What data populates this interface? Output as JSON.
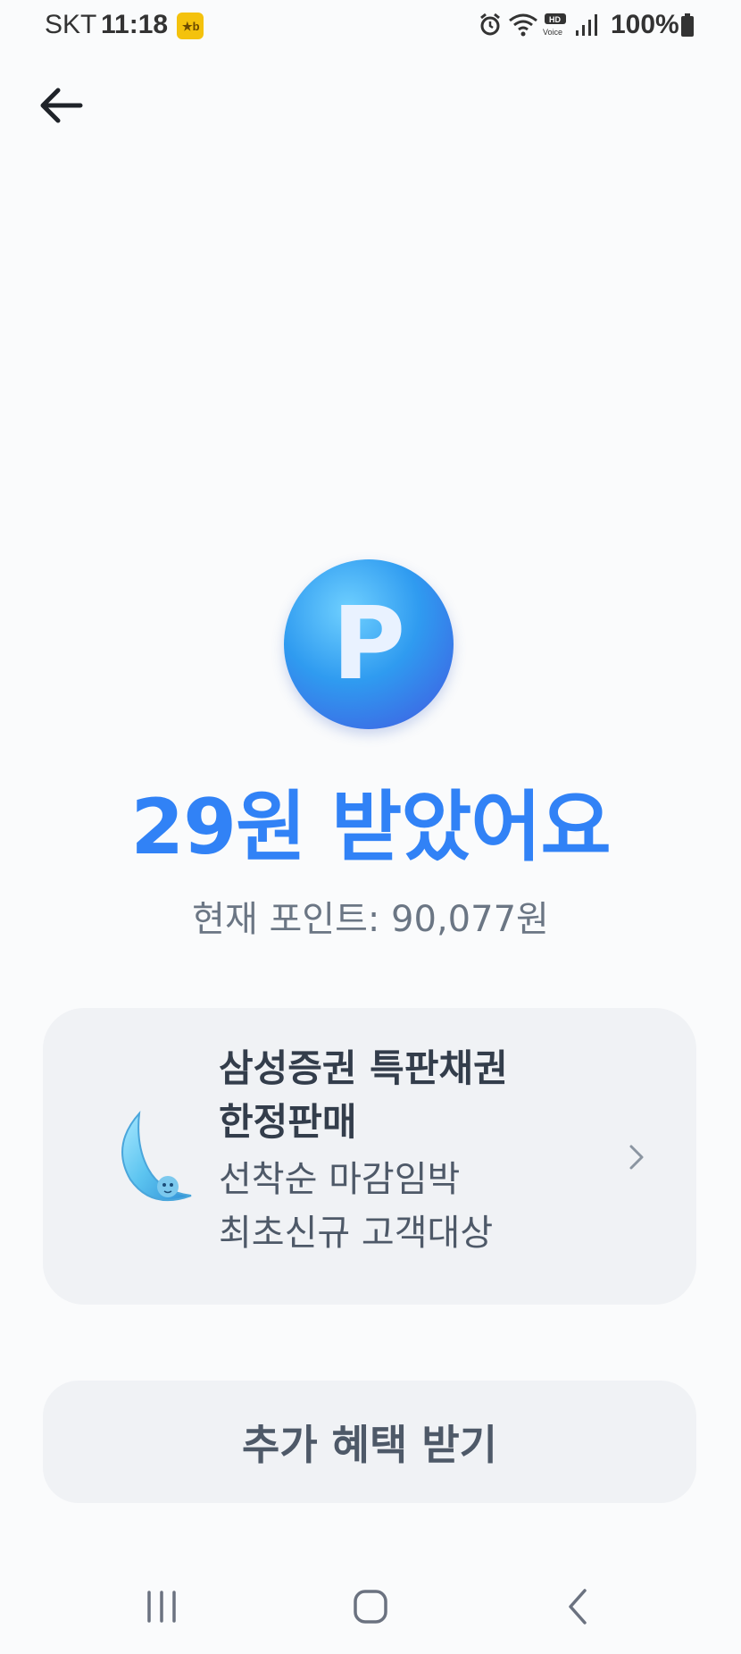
{
  "status_bar": {
    "carrier": "SKT",
    "time": "11:18",
    "badge_icon": "kb-pay-badge",
    "icons": [
      "alarm-icon",
      "wifi-icon",
      "hd-voice-icon",
      "signal-icon"
    ],
    "battery": "100%"
  },
  "header": {
    "back_icon": "arrow-left-icon"
  },
  "reward": {
    "coin_letter": "P",
    "title": "29원 받았어요",
    "current_points": "현재 포인트: 90,077원"
  },
  "promo": {
    "icon": "moon-mascot-icon",
    "title": "삼성증권 특판채권\n한정판매",
    "description": "선착순 마감임박\n최초신규 고객대상"
  },
  "actions": {
    "extra_benefit_label": "추가 혜택 받기"
  },
  "nav_bar": {
    "icons": [
      "recent-apps-icon",
      "home-icon",
      "back-icon"
    ]
  },
  "colors": {
    "accent": "#3182f6",
    "card_background": "#f0f2f5",
    "background": "#fafbfc"
  }
}
